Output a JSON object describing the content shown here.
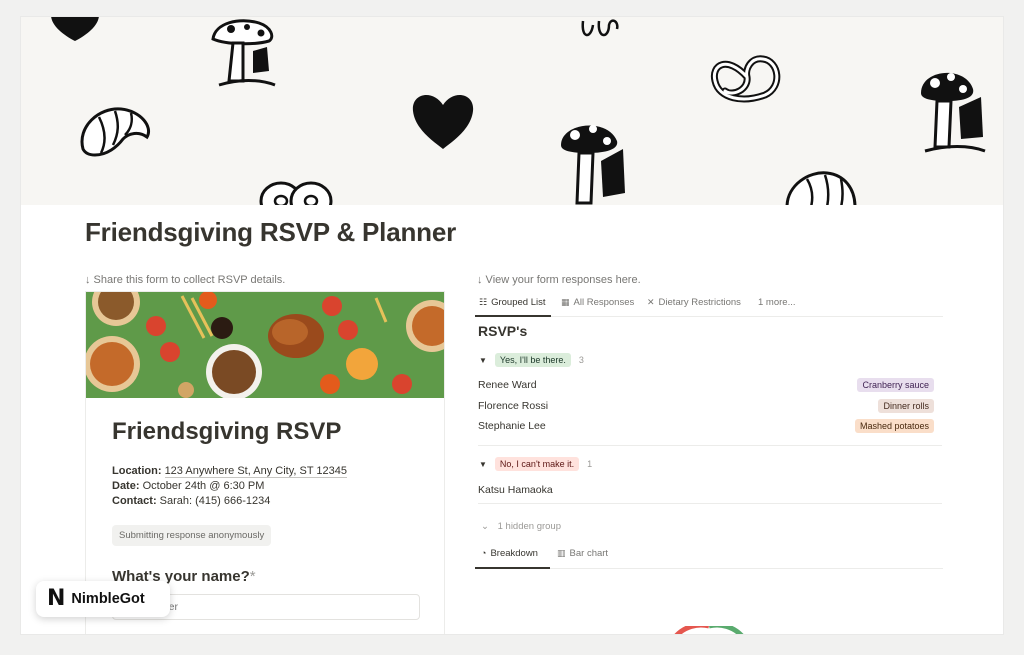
{
  "page": {
    "title": "Friendsgiving RSVP & Planner"
  },
  "hints": {
    "left": "↓ Share this form to collect RSVP details.",
    "right": "↓ View your form responses here."
  },
  "cover": {
    "icons": [
      "heart-icon",
      "mushroom-gnome-icon",
      "croissant-icon",
      "pretzel-icon",
      "bagel-icon"
    ]
  },
  "form": {
    "title": "Friendsgiving RSVP",
    "location_label": "Location:",
    "location_value": "123 Anywhere St, Any City, ST 12345",
    "date_label": "Date:",
    "date_value": "October 24th @ 6:30 PM",
    "contact_label": "Contact:",
    "contact_value": "Sarah: (415) 666-1234",
    "anonymous_note": "Submitting response anonymously",
    "question": "What's your name?",
    "required_mark": "*",
    "answer_placeholder": "Your answer"
  },
  "view_tabs": [
    {
      "label": "Grouped List",
      "icon": "list-icon",
      "active": true
    },
    {
      "label": "All Responses",
      "icon": "table-icon",
      "active": false
    },
    {
      "label": "Dietary Restrictions",
      "icon": "utensils-icon",
      "active": false
    },
    {
      "label": "1 more...",
      "icon": "",
      "active": false
    }
  ],
  "rsvps": {
    "heading": "RSVP's",
    "groups": [
      {
        "label": "Yes, I'll be there.",
        "count": "3",
        "color": "#dbeddb",
        "rows": [
          {
            "name": "Renee Ward",
            "dish": "Cranberry sauce",
            "dish_bg": "#e8deee",
            "dish_fg": "#412454"
          },
          {
            "name": "Florence Rossi",
            "dish": "Dinner rolls",
            "dish_bg": "#eee0da",
            "dish_fg": "#442a1e"
          },
          {
            "name": "Stephanie Lee",
            "dish": "Mashed potatoes",
            "dish_bg": "#fadec9",
            "dish_fg": "#49290e"
          }
        ]
      },
      {
        "label": "No, I can't make it.",
        "count": "1",
        "color": "#ffe2dd",
        "rows": [
          {
            "name": "Katsu Hamaoka",
            "dish": "",
            "dish_bg": "",
            "dish_fg": ""
          }
        ]
      }
    ],
    "hidden_group": "1 hidden group"
  },
  "chart_tabs": [
    {
      "label": "Breakdown",
      "icon": "clock-icon",
      "active": true
    },
    {
      "label": "Bar chart",
      "icon": "bar-chart-icon",
      "active": false
    }
  ],
  "badge": {
    "logo": "N",
    "text": "NimbleGot"
  }
}
